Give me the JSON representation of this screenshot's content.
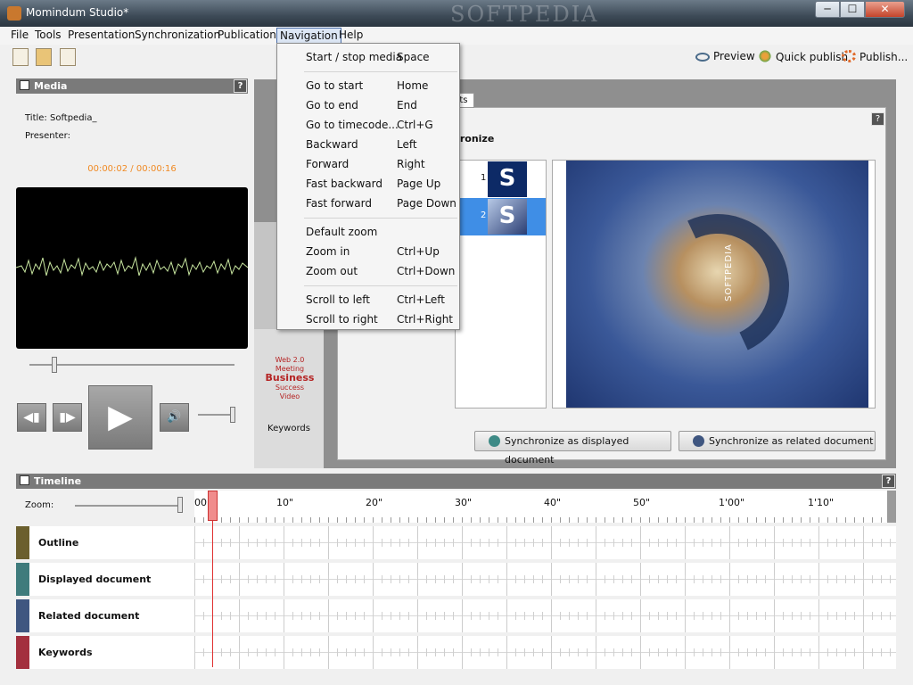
{
  "window": {
    "title": "Momindum Studio*",
    "watermark": "SOFTPEDIA",
    "min": "─",
    "max": "☐",
    "close": "✕"
  },
  "menubar": {
    "items": [
      "File",
      "Tools",
      "Presentation",
      "Synchronization",
      "Publication",
      "Navigation",
      "Help"
    ],
    "active": "Navigation"
  },
  "toolbar": {
    "preview": "Preview",
    "quick_publish": "Quick publish",
    "publish": "Publish..."
  },
  "media": {
    "header": "Media",
    "help": "?",
    "title_line": "Title: Softpedia_",
    "presenter_line": "Presenter:",
    "time": "00:00:02 / 00:00:16",
    "seek_fraction": 0.12,
    "volume_fraction": 0.95
  },
  "center_column": {
    "keywords_logo": [
      "Web 2.0",
      "Meeting",
      "Business",
      "Success",
      "Video"
    ],
    "keywords_label": "Keywords"
  },
  "sync_panel": {
    "tab_text": "nts",
    "heading": "hronize",
    "help": "?",
    "slides": [
      {
        "num": "1",
        "thumb": "S"
      },
      {
        "num": "2",
        "thumb": "S"
      }
    ],
    "selected_slide": 2,
    "preview_text": "SOFTPEDIA",
    "btn_displayed": "Synchronize as displayed document",
    "btn_related": "Synchronize as related document"
  },
  "timeline": {
    "header": "Timeline",
    "help": "?",
    "zoom_label": "Zoom:",
    "ticks": [
      "00\"",
      "10\"",
      "20\"",
      "30\"",
      "40\"",
      "50\"",
      "1'00\"",
      "1'10\""
    ],
    "tracks": [
      {
        "label": "Outline",
        "color": "#6b5f2e"
      },
      {
        "label": "Displayed document",
        "color": "#3f7b7c"
      },
      {
        "label": "Related document",
        "color": "#3f5680"
      },
      {
        "label": "Keywords",
        "color": "#a3303e"
      }
    ]
  },
  "navigation_menu": {
    "items": [
      {
        "label": "Start / stop media",
        "shortcut": "Space"
      },
      {
        "label": "Go to start",
        "shortcut": "Home"
      },
      {
        "label": "Go to end",
        "shortcut": "End"
      },
      {
        "label": "Go to timecode...",
        "shortcut": "Ctrl+G"
      },
      {
        "label": "Backward",
        "shortcut": "Left"
      },
      {
        "label": "Forward",
        "shortcut": "Right"
      },
      {
        "label": "Fast backward",
        "shortcut": "Page Up"
      },
      {
        "label": "Fast forward",
        "shortcut": "Page Down"
      },
      {
        "label": "Default zoom",
        "shortcut": ""
      },
      {
        "label": "Zoom in",
        "shortcut": "Ctrl+Up"
      },
      {
        "label": "Zoom out",
        "shortcut": "Ctrl+Down"
      },
      {
        "label": "Scroll to left",
        "shortcut": "Ctrl+Left"
      },
      {
        "label": "Scroll to right",
        "shortcut": "Ctrl+Right"
      }
    ]
  },
  "colors": {
    "accent_time": "#f08a24",
    "playhead": "#e03030",
    "selection": "#3f8ee6",
    "btn_displayed_dot": "#3e8a86",
    "btn_related_dot": "#3f5680"
  }
}
